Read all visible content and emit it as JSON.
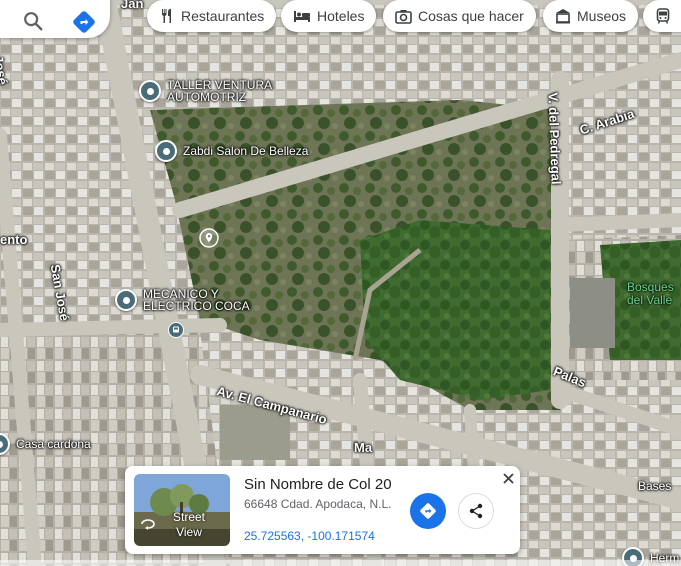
{
  "search": {
    "icon": "search-icon",
    "directions_icon": "directions-icon"
  },
  "chips": [
    {
      "label": "Restaurantes",
      "icon": "fork-knife-icon"
    },
    {
      "label": "Hoteles",
      "icon": "bed-icon"
    },
    {
      "label": "Cosas que hacer",
      "icon": "camera-icon"
    },
    {
      "label": "Museos",
      "icon": "museum-icon"
    },
    {
      "label": "",
      "icon": "transit-icon"
    }
  ],
  "pois": {
    "taller": "TALLER VENTURA\nAUTOMOTRIZ",
    "zabdi": "Zabdi Salon De Belleza",
    "mecanico": "MECANICO Y\nELECTRICO COCA",
    "casa": "Casa cardona",
    "herm": "Herm"
  },
  "streets": {
    "jan": "Jan",
    "jose_top": "José",
    "mento": "ento",
    "san_jose": "San José",
    "v_pedregal": "V. del Pedregal",
    "c_arabia": "C. Arabia",
    "campanario": "Av. El Campanario",
    "ma": "Ma",
    "palas": "Palas",
    "bases": "Bases"
  },
  "areas": {
    "bosques": "Bosques\ndel Valle"
  },
  "card": {
    "title": "Sin Nombre de Col 20",
    "address": "66648 Cdad. Apodaca, N.L.",
    "coordinates": "25.725563, -100.171574",
    "thumb_label": "Street\nView",
    "latitude": 25.725563,
    "longitude": -100.171574
  },
  "colors": {
    "accent": "#1a73e8",
    "pin": "#4a6c79",
    "park_label": "#66d08a"
  }
}
